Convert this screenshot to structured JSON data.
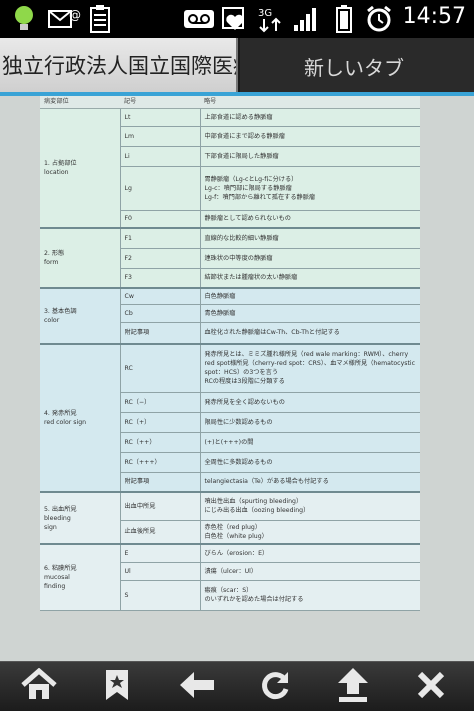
{
  "status": {
    "time": "14:57",
    "network": "3G"
  },
  "tabs": [
    {
      "label": "独立行政法人国立国際医療"
    },
    {
      "label": "新しいタブ"
    }
  ],
  "table": {
    "headers": [
      "病変部位",
      "記号",
      "略号"
    ],
    "rows": [
      {
        "style": "g",
        "cat": "1. 占拠部位\nlocation",
        "span": 5,
        "cls": "Lt",
        "desc": "上部食道に認める静脈瘤"
      },
      {
        "style": "g",
        "cls": "Lm",
        "desc": "中部食道にまで認める静脈瘤"
      },
      {
        "style": "g",
        "cls": "Li",
        "desc": "下部食道に限局した静脈瘤"
      },
      {
        "style": "g",
        "cls": "Lg",
        "desc": "胃静脈瘤（Lg-cとLg-fに分ける）\nLg-c：噴門部に限局する静脈瘤\nLg-f：噴門部から離れて孤在する静脈瘤"
      },
      {
        "style": "g",
        "cls": "F0",
        "desc": "静脈瘤として認められないもの"
      },
      {
        "style": "g",
        "cat": "2. 形態\nform",
        "span": 3,
        "sec": true,
        "cls": "F1",
        "desc": "直線的な比較的細い静脈瘤"
      },
      {
        "style": "g",
        "cls": "F2",
        "desc": "連珠状の中等度の静脈瘤"
      },
      {
        "style": "g",
        "cls": "F3",
        "desc": "結節状または腫瘤状の太い静脈瘤"
      },
      {
        "style": "b",
        "cat": "3. 基本色調\ncolor",
        "span": 3,
        "sec": true,
        "cls": "Cw",
        "desc": "白色静脈瘤"
      },
      {
        "style": "b",
        "cls": "Cb",
        "desc": "青色静脈瘤"
      },
      {
        "style": "b",
        "cls": "附記事項",
        "desc": "血栓化された静脈瘤はCw-Th、Cb-Thと付記する"
      },
      {
        "style": "b",
        "cat": "4. 発赤所見\nred color sign",
        "span": 6,
        "sec": true,
        "cls": "RC",
        "desc": "発赤所見とは、ミミズ腫れ様所見（red wale marking：RWM）、cherry red spot様所見（cherry-red spot：CRS）、血マメ様所見（hematocystic spot：HCS）の3つを言う\nRCの程度は3段階に分類する"
      },
      {
        "style": "b",
        "cls": "RC（−）",
        "desc": "発赤所見を全く認めないもの"
      },
      {
        "style": "b",
        "cls": "RC（+）",
        "desc": "限局性に少数認めるもの"
      },
      {
        "style": "b",
        "cls": "RC（++）",
        "desc": "(+)と(+++)の間"
      },
      {
        "style": "b",
        "cls": "RC（+++）",
        "desc": "全周性に多数認めるもの"
      },
      {
        "style": "b",
        "cls": "附記事項",
        "desc": "telangiectasia（Te）がある場合も付記する"
      },
      {
        "style": "w",
        "cat": "5. 出血所見\nbleeding\nsign",
        "span": 2,
        "sec": true,
        "cls": "出血中所見",
        "desc": "噴出性出血（spurting bleeding）\nにじみ出る出血（oozing bleeding）"
      },
      {
        "style": "w",
        "cls": "止血後所見",
        "desc": "赤色栓（red plug）\n白色栓（white plug）"
      },
      {
        "style": "w",
        "cat": "6. 粘膜所見\nmucosal\nfinding",
        "span": 3,
        "sec": true,
        "cls": "E",
        "desc": "びらん（erosion：E）"
      },
      {
        "style": "w",
        "cls": "Ul",
        "desc": "潰瘍（ulcer：Ul）"
      },
      {
        "style": "w",
        "cls": "S",
        "desc": "瘢痕（scar：S）\nのいずれかを認めた場合は付記する"
      }
    ]
  },
  "toolbar": {
    "home": "home-icon",
    "bookmark": "bookmark-icon",
    "back": "back-arrow-icon",
    "reload": "reload-icon",
    "upload": "upload-icon",
    "close": "close-icon"
  }
}
